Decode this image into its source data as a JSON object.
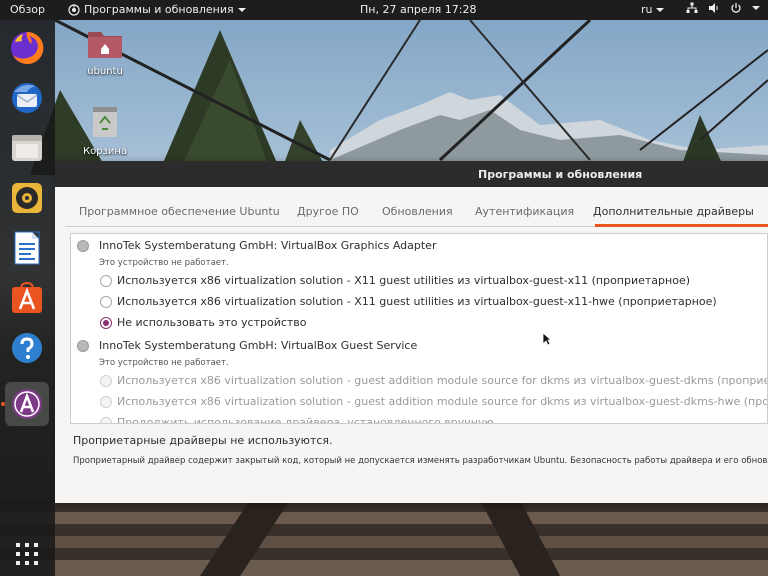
{
  "topbar": {
    "activities": "Обзор",
    "app_name": "Программы и обновления",
    "clock": "Пн, 27 апреля  17:28",
    "lang": "ru"
  },
  "desktop": {
    "home_label": "ubuntu",
    "trash_label": "Корзина"
  },
  "dock": {
    "items": [
      "firefox-icon",
      "thunderbird-icon",
      "files-icon",
      "rhythmbox-icon",
      "writer-icon",
      "software-center-icon",
      "help-icon",
      "software-updater-icon"
    ],
    "apps_grid": "show-applications-icon"
  },
  "window": {
    "title": "Программы и обновления",
    "tabs": [
      {
        "label": "Программное обеспечение Ubuntu"
      },
      {
        "label": "Другое ПО"
      },
      {
        "label": "Обновления"
      },
      {
        "label": "Аутентификация"
      },
      {
        "label": "Дополнительные драйверы"
      }
    ],
    "devices": [
      {
        "title": "InnoTek Systemberatung GmbH: VirtualBox Graphics Adapter",
        "status": "Это устройство не работает.",
        "options": [
          {
            "label": "Используется x86 virtualization solution - X11 guest utilities из virtualbox-guest-x11 (проприетарное)",
            "checked": false
          },
          {
            "label": "Используется x86 virtualization solution - X11 guest utilities из virtualbox-guest-x11-hwe (проприетарное)",
            "checked": false
          },
          {
            "label": "Не использовать это устройство",
            "checked": true
          }
        ]
      },
      {
        "title": "InnoTek Systemberatung GmbH: VirtualBox Guest Service",
        "status": "Это устройство не работает.",
        "options": [
          {
            "label": "Используется x86 virtualization solution - guest addition module source for dkms из virtualbox-guest-dkms (проприетарное)",
            "checked": false
          },
          {
            "label": "Используется x86 virtualization solution - guest addition module source for dkms из virtualbox-guest-dkms-hwe (проприетарное)",
            "checked": false
          },
          {
            "label": "Продолжить использование драйвера, установленного вручную",
            "checked": false
          }
        ]
      }
    ],
    "footer_status": "Проприетарные драйверы не используются.",
    "footer_note": "Проприетарный драйвер содержит закрытый код, который не допускается изменять разработчикам Ubuntu. Безопасность работы драйвера и его обновление з"
  },
  "colors": {
    "accent": "#e95420",
    "radio_checked": "#8a2f6b",
    "topbar": "#1d1d1d",
    "window_title": "#2c2c2c"
  }
}
